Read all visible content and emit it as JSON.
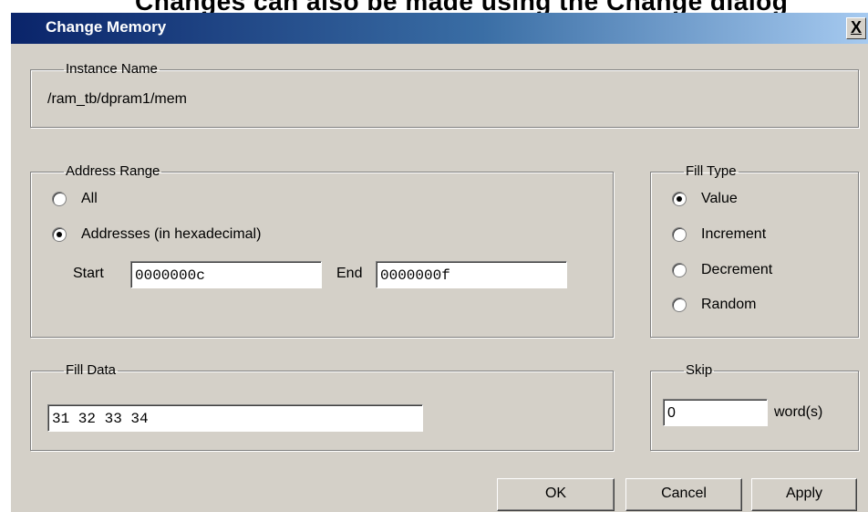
{
  "background_text": "Changes can also be made using the Change dialog",
  "window": {
    "title": "Change Memory",
    "close_label": "X"
  },
  "instance": {
    "legend": "Instance Name",
    "value": "/ram_tb/dpram1/mem"
  },
  "address_range": {
    "legend": "Address Range",
    "options": [
      {
        "label": "All",
        "checked": false
      },
      {
        "label": "Addresses (in hexadecimal)",
        "checked": true
      }
    ],
    "start_label": "Start",
    "start_value": "0000000c",
    "end_label": "End",
    "end_value": "0000000f"
  },
  "fill_type": {
    "legend": "Fill Type",
    "options": [
      {
        "label": "Value",
        "checked": true
      },
      {
        "label": "Increment",
        "checked": false
      },
      {
        "label": "Decrement",
        "checked": false
      },
      {
        "label": "Random",
        "checked": false
      }
    ]
  },
  "fill_data": {
    "legend": "Fill Data",
    "value": "31 32 33 34"
  },
  "skip": {
    "legend": "Skip",
    "value": "0",
    "unit_label": "word(s)"
  },
  "buttons": {
    "ok": "OK",
    "cancel": "Cancel",
    "apply": "Apply"
  }
}
